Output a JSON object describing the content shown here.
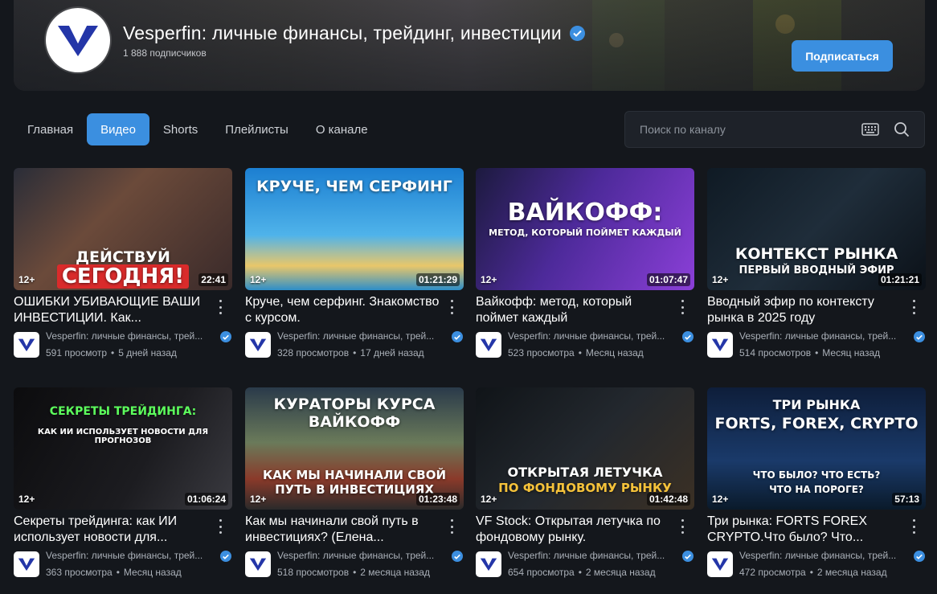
{
  "channel": {
    "title": "Vesperfin: личные финансы, трейдинг, инвестиции",
    "subscribers": "1 888 подписчиков",
    "subscribe_label": "Подписаться"
  },
  "tabs": [
    {
      "label": "Главная",
      "active": false
    },
    {
      "label": "Видео",
      "active": true
    },
    {
      "label": "Shorts",
      "active": false
    },
    {
      "label": "Плейлисты",
      "active": false
    },
    {
      "label": "О канале",
      "active": false
    }
  ],
  "search": {
    "placeholder": "Поиск по каналу"
  },
  "colors": {
    "accent": "#3b8fe0",
    "background": "#14171c"
  },
  "videos": [
    {
      "title": "ОШИБКИ УБИВАЮЩИЕ ВАШИ ИНВЕСТИЦИИ. Как...",
      "channel": "Vesperfin: личные финансы, трей...",
      "views": "591 просмотр",
      "age": "5 дней назад",
      "duration": "22:41",
      "rating": "12+",
      "thumb_text": [
        "ДЕЙСТВУЙ",
        "СЕГОДНЯ!"
      ]
    },
    {
      "title": "Круче, чем серфинг. Знакомство с курсом.",
      "channel": "Vesperfin: личные финансы, трей...",
      "views": "328 просмотров",
      "age": "17 дней назад",
      "duration": "01:21:29",
      "rating": "12+",
      "thumb_text": [
        "КРУЧЕ, ЧЕМ СЕРФИНГ"
      ]
    },
    {
      "title": "Вайкофф: метод, который поймет каждый",
      "channel": "Vesperfin: личные финансы, трей...",
      "views": "523 просмотра",
      "age": "Месяц назад",
      "duration": "01:07:47",
      "rating": "12+",
      "thumb_text": [
        "ВАЙКОФФ:",
        "МЕТОД, КОТОРЫЙ ПОЙМЕТ КАЖДЫЙ"
      ]
    },
    {
      "title": "Вводный эфир по контексту рынка в 2025 году",
      "channel": "Vesperfin: личные финансы, трей...",
      "views": "514 просмотров",
      "age": "Месяц назад",
      "duration": "01:21:21",
      "rating": "12+",
      "thumb_text": [
        "КОНТЕКСТ РЫНКА",
        "ПЕРВЫЙ ВВОДНЫЙ ЭФИР"
      ]
    },
    {
      "title": "Секреты трейдинга: как ИИ использует новости для...",
      "channel": "Vesperfin: личные финансы, трей...",
      "views": "363 просмотра",
      "age": "Месяц назад",
      "duration": "01:06:24",
      "rating": "12+",
      "thumb_text": [
        "СЕКРЕТЫ ТРЕЙДИНГА:",
        "КАК ИИ ИСПОЛЬЗУЕТ НОВОСТИ ДЛЯ ПРОГНОЗОВ"
      ]
    },
    {
      "title": "Как мы начинали свой путь в инвестициях? (Елена...",
      "channel": "Vesperfin: личные финансы, трей...",
      "views": "518 просмотров",
      "age": "2 месяца назад",
      "duration": "01:23:48",
      "rating": "12+",
      "thumb_text": [
        "КУРАТОРЫ КУРСА ВАЙКОФФ",
        "КАК МЫ НАЧИНАЛИ СВОЙ ПУТЬ В ИНВЕСТИЦИЯХ"
      ]
    },
    {
      "title": "VF Stock: Открытая летучка по фондовому рынку.",
      "channel": "Vesperfin: личные финансы, трей...",
      "views": "654 просмотра",
      "age": "2 месяца назад",
      "duration": "01:42:48",
      "rating": "12+",
      "thumb_text": [
        "ОТКРЫТАЯ ЛЕТУЧКА",
        "ПО ФОНДОВОМУ РЫНКУ"
      ]
    },
    {
      "title": "Три рынка: FORTS FOREX CRYPTO.Что было? Что...",
      "channel": "Vesperfin: личные финансы, трей...",
      "views": "472 просмотра",
      "age": "2 месяца назад",
      "duration": "57:13",
      "rating": "12+",
      "thumb_text": [
        "ТРИ РЫНКА",
        "FORTS, FOREX, CRYPTO",
        "ЧТО БЫЛО? ЧТО ЕСТЬ?",
        "ЧТО НА ПОРОГЕ?"
      ]
    }
  ]
}
